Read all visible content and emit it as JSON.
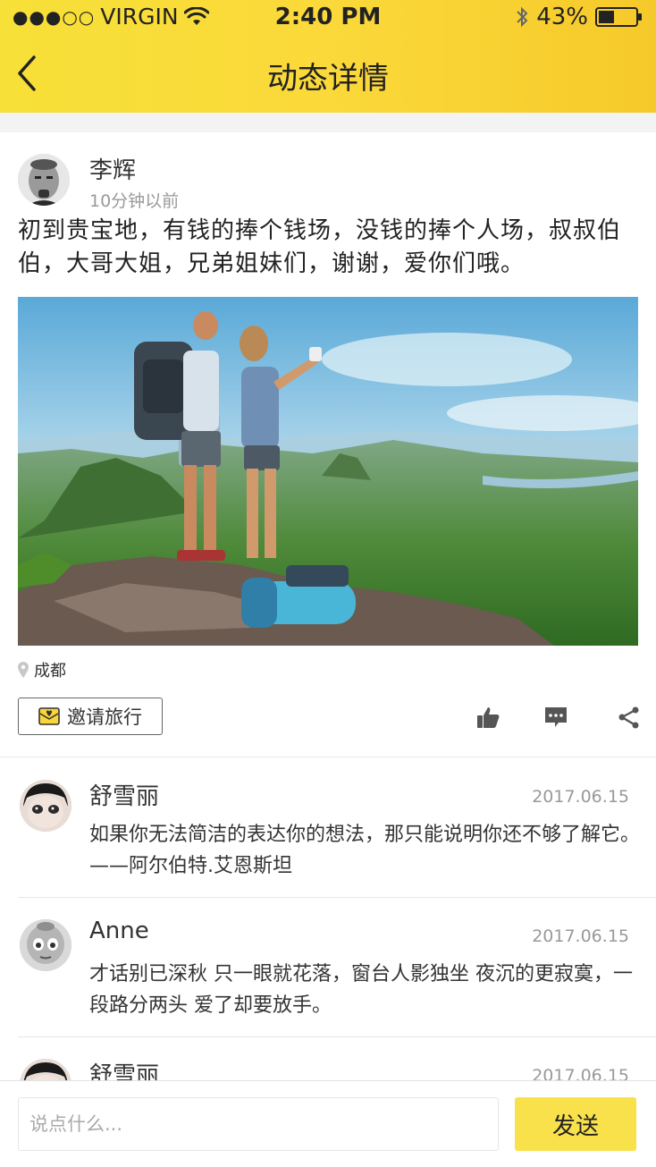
{
  "status_bar": {
    "signal": "●●●○○",
    "carrier": "VIRGIN",
    "time": "2:40 PM",
    "battery_percent": "43%",
    "battery_level": 0.43
  },
  "nav": {
    "title": "动态详情",
    "back_icon": "chevron-left-icon"
  },
  "post": {
    "author": "李辉",
    "time": "10分钟以前",
    "text": "初到贵宝地，有钱的捧个钱场，没钱的捧个人场，叔叔伯伯，大哥大姐，兄弟姐妹们，谢谢，爱你们哦。",
    "location": "成都",
    "invite_label": "邀请旅行",
    "actions": [
      "thumbs-up-icon",
      "comment-icon",
      "share-icon"
    ]
  },
  "comments": [
    {
      "name": "舒雪丽",
      "date": "2017.06.15",
      "text": "如果你无法简洁的表达你的想法，那只能说明你还不够了解它。——阿尔伯特.艾恩斯坦"
    },
    {
      "name": "Anne",
      "date": "2017.06.15",
      "text": "才话别已深秋 只一眼就花落，窗台人影独坐 夜沉的更寂寞，一段路分两头 爱了却要放手。"
    },
    {
      "name": "舒雪丽",
      "date": "2017.06.15",
      "text": ""
    }
  ],
  "footer": {
    "input_placeholder": "说点什么...",
    "send_label": "发送"
  },
  "colors": {
    "header_yellow": "#fbd93a",
    "send_button": "#f8e14b",
    "muted_text": "#999999"
  }
}
